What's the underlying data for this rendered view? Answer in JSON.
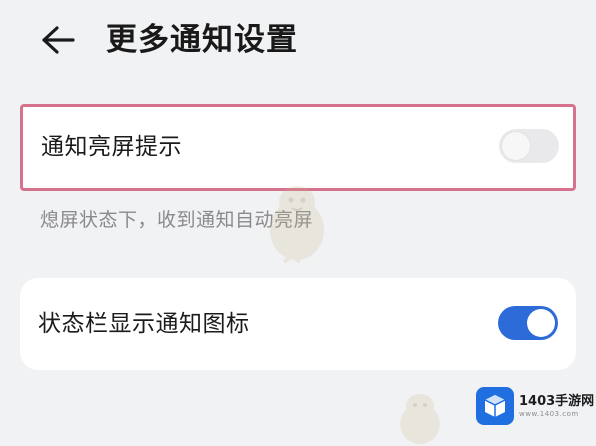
{
  "header": {
    "title": "更多通知设置",
    "back_icon": "arrow-left-icon"
  },
  "settings": [
    {
      "label": "通知亮屏提示",
      "toggle_state": "off",
      "highlighted": true,
      "description": "熄屏状态下，收到通知自动亮屏"
    },
    {
      "label": "状态栏显示通知图标",
      "toggle_state": "on",
      "highlighted": false
    }
  ],
  "watermark": {
    "site_name": "1403手游网",
    "site_url": "www.1403.com",
    "logo_icon": "cube-logo-icon",
    "mascot_icon": "bird-mascot-icon"
  },
  "colors": {
    "background": "#f1f2f4",
    "card": "#ffffff",
    "highlight_border": "#d5728c",
    "toggle_on": "#2d6bd9",
    "toggle_off": "#e9e9eb",
    "description_text": "#8a8a8d",
    "brand_logo": "#1f6fe0"
  }
}
